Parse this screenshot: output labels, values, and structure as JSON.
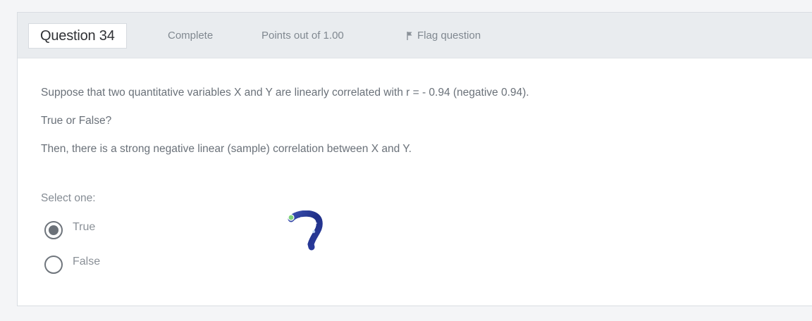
{
  "question": {
    "number_label": "Question 34",
    "status": "Complete",
    "points": "Points out of 1.00",
    "flag_label": "Flag question"
  },
  "body": {
    "statement": "Suppose that two quantitative variables X and Y are linearly correlated with r = - 0.94 (negative 0.94).",
    "prompt": "True or False?",
    "claim": "Then, there is a strong negative linear (sample) correlation between X and Y."
  },
  "answer": {
    "select_label": "Select one:",
    "options": [
      {
        "label": "True",
        "selected": true
      },
      {
        "label": "False",
        "selected": false
      }
    ]
  },
  "icons": {
    "flag": "flag-icon",
    "cursor": "question-mark-cursor-icon"
  },
  "colors": {
    "header_bg": "#e9ecef",
    "card_bg": "#ffffff",
    "text": "#6a7179"
  }
}
